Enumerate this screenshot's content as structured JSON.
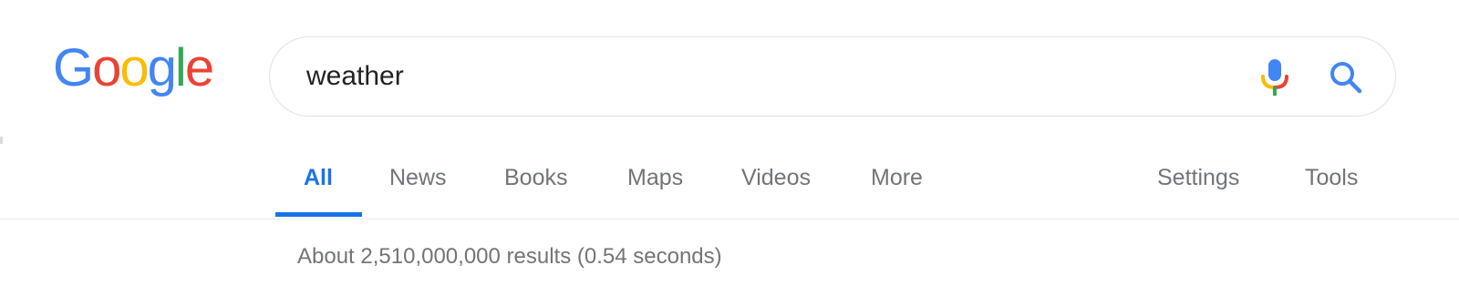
{
  "logo": {
    "letters": [
      {
        "ch": "G",
        "color": "#4285F4"
      },
      {
        "ch": "o",
        "color": "#EA4335"
      },
      {
        "ch": "o",
        "color": "#FBBC05"
      },
      {
        "ch": "g",
        "color": "#4285F4"
      },
      {
        "ch": "l",
        "color": "#34A853"
      },
      {
        "ch": "e",
        "color": "#EA4335"
      }
    ]
  },
  "search": {
    "query": "weather",
    "mic_icon": "microphone-icon",
    "search_icon": "magnifier-icon"
  },
  "tabs": {
    "all": "All",
    "news": "News",
    "books": "Books",
    "maps": "Maps",
    "videos": "Videos",
    "more": "More",
    "settings": "Settings",
    "tools": "Tools",
    "active": "All"
  },
  "results": {
    "stats": "About 2,510,000,000 results (0.54 seconds)"
  },
  "colors": {
    "accent": "#1a73e8",
    "muted_text": "#70757a",
    "border": "#dfe1e5"
  }
}
